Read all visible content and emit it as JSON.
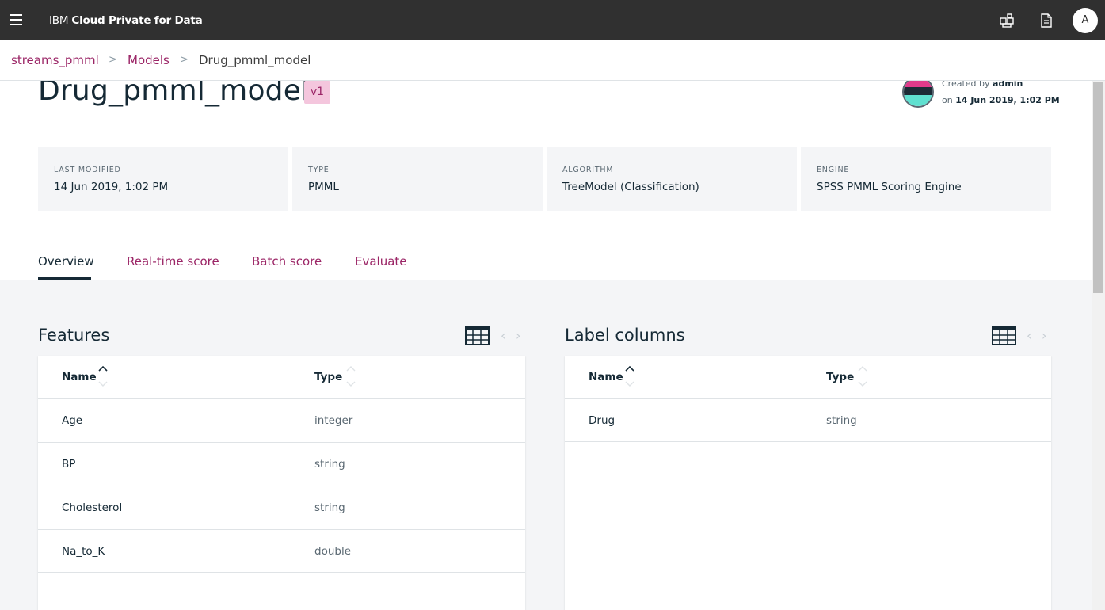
{
  "topbar": {
    "brand_prefix": "IBM",
    "brand_name": "Cloud Private for Data",
    "user_initial": "A"
  },
  "breadcrumb": [
    "streams_pmml",
    "Models",
    "Drug_pmml_model"
  ],
  "model": {
    "title": "Drug_pmml_model",
    "version": "v1",
    "created_by_label": "Created by",
    "created_by_user": "admin",
    "created_on_label": "on",
    "created_on_date": "14 Jun 2019, 1:02 PM"
  },
  "meta": [
    {
      "label": "LAST MODIFIED",
      "value": "14 Jun 2019, 1:02 PM"
    },
    {
      "label": "TYPE",
      "value": "PMML"
    },
    {
      "label": "ALGORITHM",
      "value": "TreeModel (Classification)"
    },
    {
      "label": "ENGINE",
      "value": "SPSS PMML Scoring Engine"
    }
  ],
  "tabs": [
    "Overview",
    "Real-time score",
    "Batch score",
    "Evaluate"
  ],
  "features": {
    "title": "Features",
    "columns": [
      "Name",
      "Type"
    ],
    "rows": [
      [
        "Age",
        "integer"
      ],
      [
        "BP",
        "string"
      ],
      [
        "Cholesterol",
        "string"
      ],
      [
        "Na_to_K",
        "double"
      ]
    ]
  },
  "labels": {
    "title": "Label columns",
    "columns": [
      "Name",
      "Type"
    ],
    "rows": [
      [
        "Drug",
        "string"
      ]
    ]
  },
  "colors": {
    "accent": "#9b2566",
    "topbar": "#303030",
    "version_bg": "#f4c6dd"
  }
}
